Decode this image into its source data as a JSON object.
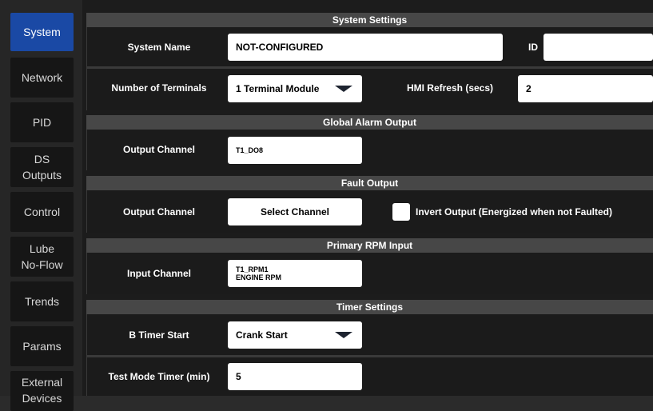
{
  "sidebar": {
    "items": [
      {
        "label": "System"
      },
      {
        "label": "Network"
      },
      {
        "label": "PID"
      },
      {
        "label": "DS\nOutputs"
      },
      {
        "label": "Control"
      },
      {
        "label": "Lube\nNo-Flow"
      },
      {
        "label": "Trends"
      },
      {
        "label": "Params"
      },
      {
        "label": "External\nDevices"
      }
    ],
    "active_color": "#1a49a5"
  },
  "system_settings": {
    "title": "System Settings",
    "system_name_label": "System Name",
    "system_name_value": "NOT-CONFIGURED",
    "id_label": "ID",
    "id_value": "",
    "terminals_label": "Number of Terminals",
    "terminals_value": "1 Terminal Module",
    "hmi_refresh_label": "HMI Refresh (secs)",
    "hmi_refresh_value": "2"
  },
  "global_alarm": {
    "title": "Global Alarm Output",
    "channel_label": "Output Channel",
    "channel_value": "T1_DO8"
  },
  "fault_output": {
    "title": "Fault Output",
    "channel_label": "Output Channel",
    "channel_button": "Select Channel",
    "invert_checked": false,
    "invert_label": "Invert Output (Energized when not Faulted)"
  },
  "primary_rpm": {
    "title": "Primary RPM Input",
    "channel_label": "Input Channel",
    "channel_value": "T1_RPM1\nENGINE RPM"
  },
  "timer_settings": {
    "title": "Timer Settings",
    "b_timer_label": "B Timer Start",
    "b_timer_value": "Crank Start",
    "test_mode_label": "Test Mode Timer (min)",
    "test_mode_value": "5"
  }
}
